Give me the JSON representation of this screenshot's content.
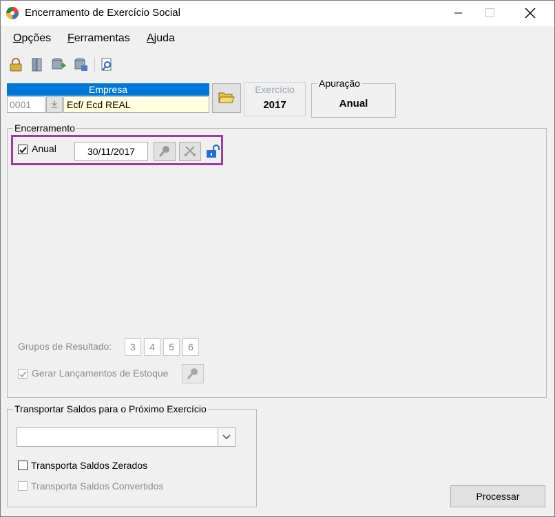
{
  "window": {
    "title": "Encerramento de Exercício Social"
  },
  "menu": [
    {
      "label": "Opções",
      "accel": "O",
      "rest": "pções"
    },
    {
      "label": "Ferramentas",
      "accel": "F",
      "rest": "erramentas"
    },
    {
      "label": "Ajuda",
      "accel": "A",
      "rest": "juda"
    }
  ],
  "empresa": {
    "header": "Empresa",
    "code": "0001",
    "name": "Ecf/ Ecd REAL"
  },
  "exercicio": {
    "label": "Exercício",
    "value": "2017"
  },
  "apuracao": {
    "label": "Apuração",
    "value": "Anual"
  },
  "encerramento": {
    "legend": "Encerramento",
    "anual_label": "Anual",
    "anual_checked": true,
    "date": "30/11/2017",
    "grupos_label": "Grupos de Resultado:",
    "grupos": [
      "3",
      "4",
      "5",
      "6"
    ],
    "gerar_label": "Gerar Lançamentos de Estoque",
    "gerar_checked": true
  },
  "transportar": {
    "legend": "Transportar Saldos para o Próximo Exercício",
    "select_value": "",
    "zerados_label": "Transporta Saldos Zerados",
    "convertidos_label": "Transporta Saldos Convertidos"
  },
  "processar_label": "Processar",
  "colors": {
    "highlight": "#9b3c9e",
    "empresa_header": "#0078d7",
    "name_field": "#ffffe1"
  }
}
